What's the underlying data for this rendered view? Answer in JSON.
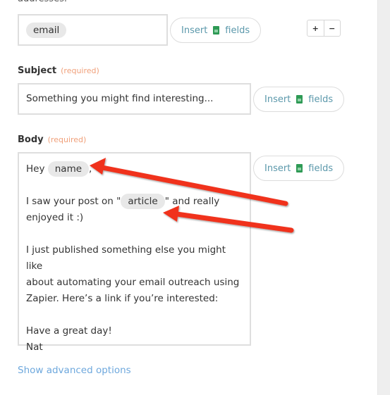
{
  "partial_top_text": "addresses.",
  "to_field": {
    "tokens": [
      "email"
    ],
    "insert_button": {
      "label_before": "Insert",
      "label_after": "fields",
      "icon": "spreadsheet-icon"
    },
    "add_label": "+",
    "remove_label": "−"
  },
  "subject": {
    "label": "Subject",
    "required_label": "(required)",
    "value": "Something you might find interesting...",
    "insert_button": {
      "label_before": "Insert",
      "label_after": "fields",
      "icon": "spreadsheet-icon"
    }
  },
  "body": {
    "label": "Body",
    "required_label": "(required)",
    "line1_prefix": "Hey",
    "line1_token": "name",
    "line1_suffix": ",",
    "line2_prefix": "I saw your post on \"",
    "line2_token": "article",
    "line2_suffix": "\" and really",
    "line3": "enjoyed it :)",
    "line4": "I just published something else you might like",
    "line5": "about automating your email outreach using",
    "line6": "Zapier. Here’s a link if you’re interested:",
    "line7": "Have a great day!",
    "line8": "Nat",
    "insert_button": {
      "label_before": "Insert",
      "label_after": "fields",
      "icon": "spreadsheet-icon"
    }
  },
  "advanced_link": "Show advanced options",
  "annotations": {
    "arrow_color": "#f0321e",
    "arrows": [
      {
        "points_to": "name token"
      },
      {
        "points_to": "article token"
      }
    ]
  }
}
